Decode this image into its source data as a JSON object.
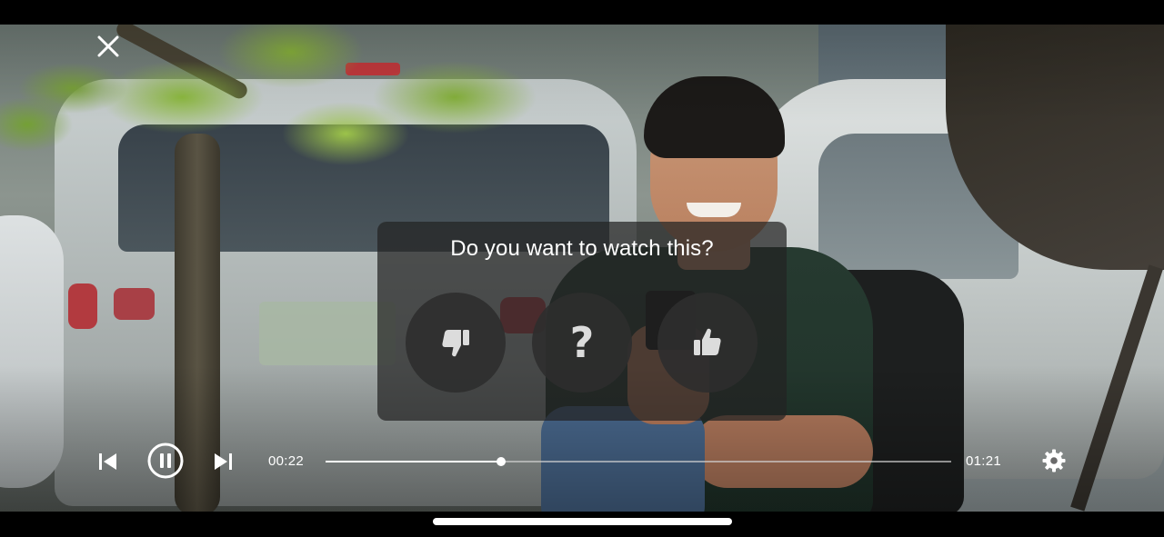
{
  "player": {
    "close_icon": "close-icon",
    "controls": {
      "previous_icon": "skip-previous-icon",
      "pause_icon": "pause-icon",
      "next_icon": "skip-next-icon",
      "settings_icon": "gear-icon",
      "current_time": "00:22",
      "duration": "01:21",
      "progress": 0.28
    }
  },
  "rating_prompt": {
    "title": "Do you want to watch this?",
    "options": [
      {
        "label": "thumbs-down",
        "icon": "thumbs-down-icon"
      },
      {
        "label": "?",
        "icon": "question-mark-icon"
      },
      {
        "label": "thumbs-up",
        "icon": "thumbs-up-icon"
      }
    ]
  },
  "colors": {
    "overlay_bg": "#232323",
    "button_bg": "#2d2d2d",
    "icon": "#dcdcdc",
    "text": "#ffffff"
  }
}
